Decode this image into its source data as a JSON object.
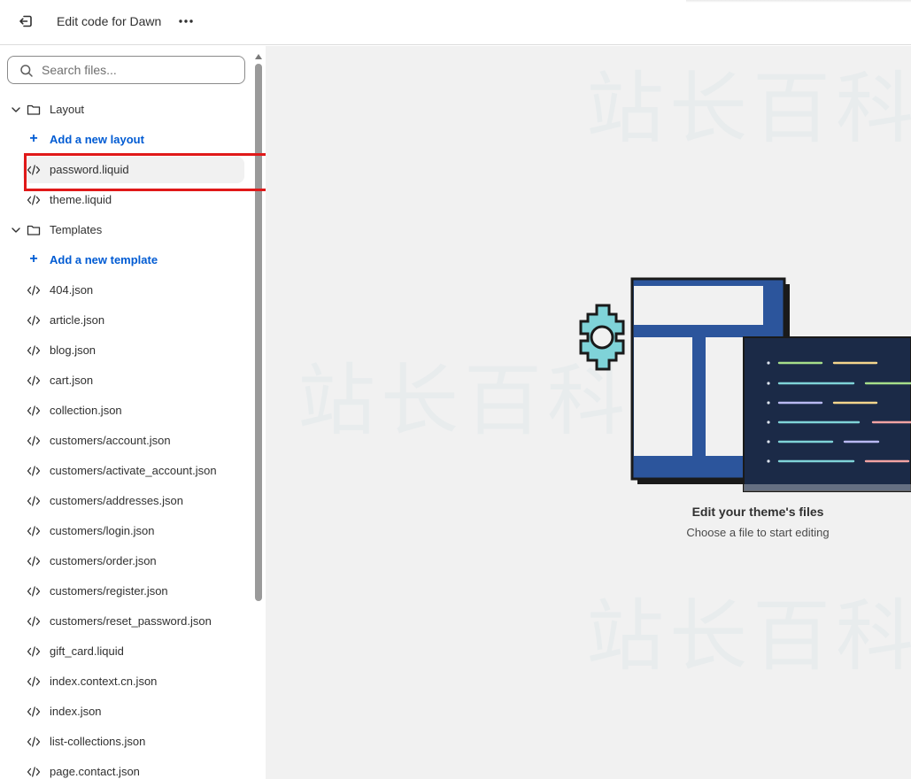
{
  "topbar": {
    "title": "Edit code for Dawn"
  },
  "search": {
    "placeholder": "Search files..."
  },
  "tree": {
    "layout_folder": "Layout",
    "layout_add": "Add a new layout",
    "layout_files": [
      "password.liquid",
      "theme.liquid"
    ],
    "templates_folder": "Templates",
    "templates_add": "Add a new template",
    "template_files": [
      "404.json",
      "article.json",
      "blog.json",
      "cart.json",
      "collection.json",
      "customers/account.json",
      "customers/activate_account.json",
      "customers/addresses.json",
      "customers/login.json",
      "customers/order.json",
      "customers/register.json",
      "customers/reset_password.json",
      "gift_card.liquid",
      "index.context.cn.json",
      "index.json",
      "list-collections.json",
      "page.contact.json"
    ],
    "selected_file": "password.liquid"
  },
  "empty_state": {
    "title": "Edit your theme's files",
    "subtitle": "Choose a file to start editing"
  },
  "colors": {
    "accent": "#005bd3",
    "highlight_box": "#e01919",
    "editor_bg": "#f1f1f1"
  },
  "icons": {
    "exit": "exit-icon",
    "more": "more-horizontal-icon",
    "search": "search-icon",
    "chevron": "chevron-down-icon",
    "folder": "folder-icon",
    "plus": "plus-icon",
    "code": "code-icon"
  }
}
